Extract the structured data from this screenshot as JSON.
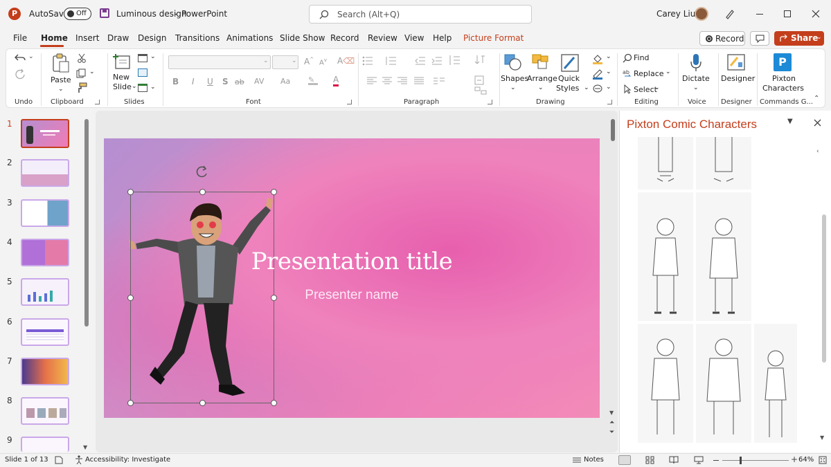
{
  "titlebar": {
    "autosave_label": "AutoSave",
    "autosave_state": "Off",
    "document_title": "Luminous design",
    "separator": "-",
    "app_name": "PowerPoint",
    "search_placeholder": "Search (Alt+Q)",
    "user_name": "Carey Liu"
  },
  "menu": {
    "tabs": [
      "File",
      "Home",
      "Insert",
      "Draw",
      "Design",
      "Transitions",
      "Animations",
      "Slide Show",
      "Record",
      "Review",
      "View",
      "Help",
      "Picture Format"
    ],
    "active_tab": "Home",
    "record_button": "Record",
    "share_button": "Share"
  },
  "ribbon": {
    "groups": {
      "undo": "Undo",
      "clipboard": "Clipboard",
      "slides": "Slides",
      "font": "Font",
      "paragraph": "Paragraph",
      "drawing": "Drawing",
      "editing": "Editing",
      "voice": "Voice",
      "designer": "Designer",
      "commands": "Commands G..."
    },
    "paste": "Paste",
    "new_slide": [
      "New",
      "Slide"
    ],
    "shapes": "Shapes",
    "arrange": "Arrange",
    "quick_styles": [
      "Quick",
      "Styles"
    ],
    "find": "Find",
    "replace": "Replace",
    "select": "Select",
    "dictate": "Dictate",
    "designer_btn": "Designer",
    "pixton": [
      "Pixton",
      "Characters"
    ],
    "font_buttons": [
      "B",
      "I",
      "U",
      "S",
      "ab",
      "AV",
      "Aa",
      "A"
    ]
  },
  "slides": {
    "numbers": [
      "1",
      "2",
      "3",
      "4",
      "5",
      "6",
      "7",
      "8",
      "9"
    ],
    "current": "1"
  },
  "slide": {
    "title": "Presentation title",
    "subtitle": "Presenter name"
  },
  "pane": {
    "title": "Pixton Comic Characters"
  },
  "status": {
    "slide_counter": "Slide 1 of 13",
    "accessibility": "Accessibility: Investigate",
    "notes": "Notes",
    "zoom": "64%"
  },
  "colors": {
    "accent": "#c43e1c",
    "slide_gradient_start": "#b58fd1",
    "slide_gradient_end": "#f07bb5"
  }
}
